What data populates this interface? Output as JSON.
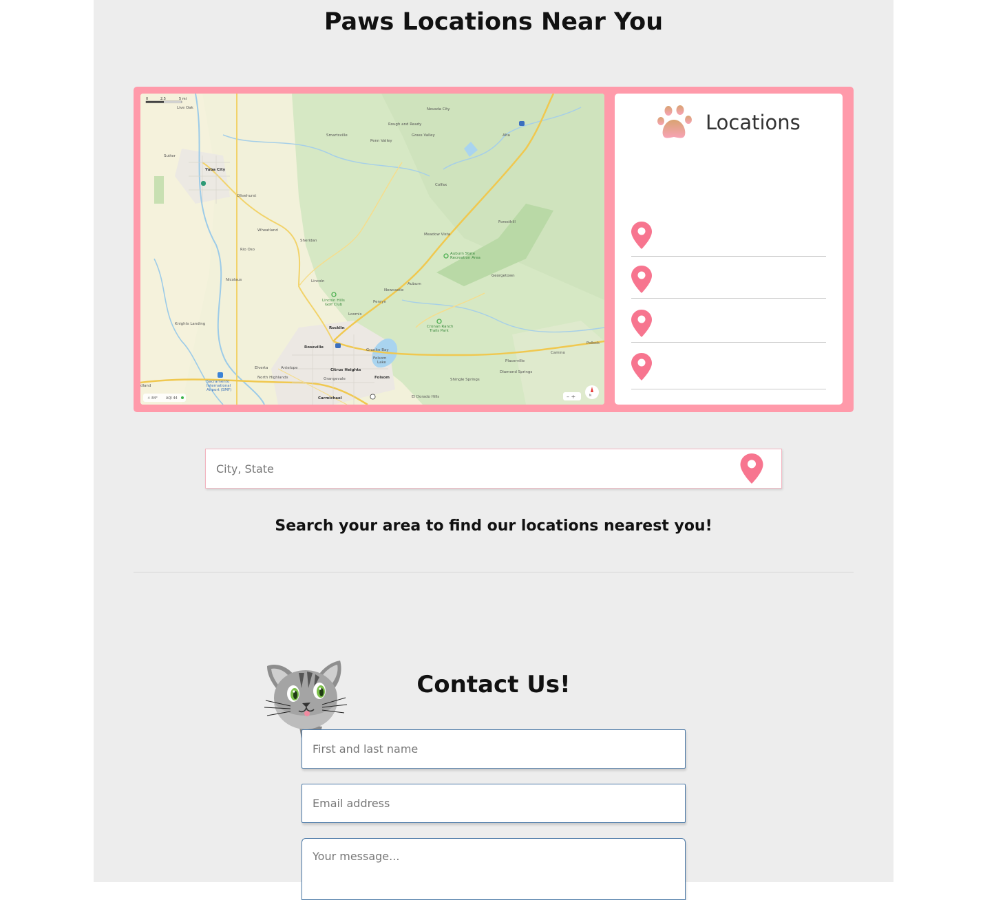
{
  "page_title": "Paws Locations Near You",
  "locations_panel": {
    "title": "Locations",
    "items": [
      "",
      "",
      "",
      ""
    ]
  },
  "search": {
    "placeholder": "City, State",
    "hint": "Search your area to find our locations nearest you!"
  },
  "map": {
    "scale": [
      "0",
      "2.5",
      "5 mi"
    ],
    "footer": "AQI 44",
    "places": [
      "Live Oak",
      "Sutter",
      "Yuba City",
      "Olivehurst",
      "Wheatland",
      "Rio Oso",
      "Sheridan",
      "Nicolaus",
      "Lincoln",
      "Knights Landing",
      "Lincoln Hills Golf Club",
      "Penryn",
      "Loomis",
      "Rocklin",
      "Roseville",
      "Granite Bay",
      "Folsom Lake",
      "Citrus Heights",
      "Elverta",
      "Antelope",
      "North Highlands",
      "Orangevale",
      "Folsom",
      "Carmichael",
      "El Dorado Hills",
      "Shingle Springs",
      "Placerville",
      "Diamond Springs",
      "Camino",
      "Pollock",
      "Cronan Ranch Trails Park",
      "Georgetown",
      "Auburn",
      "Newcastle",
      "Auburn State Recreation Area",
      "Meadow Vista",
      "Foresthill",
      "Colfax",
      "Alta",
      "Grass Valley",
      "Penn Valley",
      "Rough and Ready",
      "Nevada City",
      "Smartsville",
      "Sacramento International Airport (SMF)",
      "Woodland"
    ]
  },
  "contact": {
    "title": "Contact Us!",
    "name_placeholder": "First and last name",
    "email_placeholder": "Email address",
    "message_placeholder": "Your message..."
  },
  "colors": {
    "accent": "#ff9aaa",
    "pin": "#f7758f",
    "page_bg": "#ededed",
    "field_border": "#4a78a6"
  },
  "icons": {
    "paw": "paw-icon",
    "pin": "map-pin-icon",
    "cat": "cat-mascot"
  }
}
